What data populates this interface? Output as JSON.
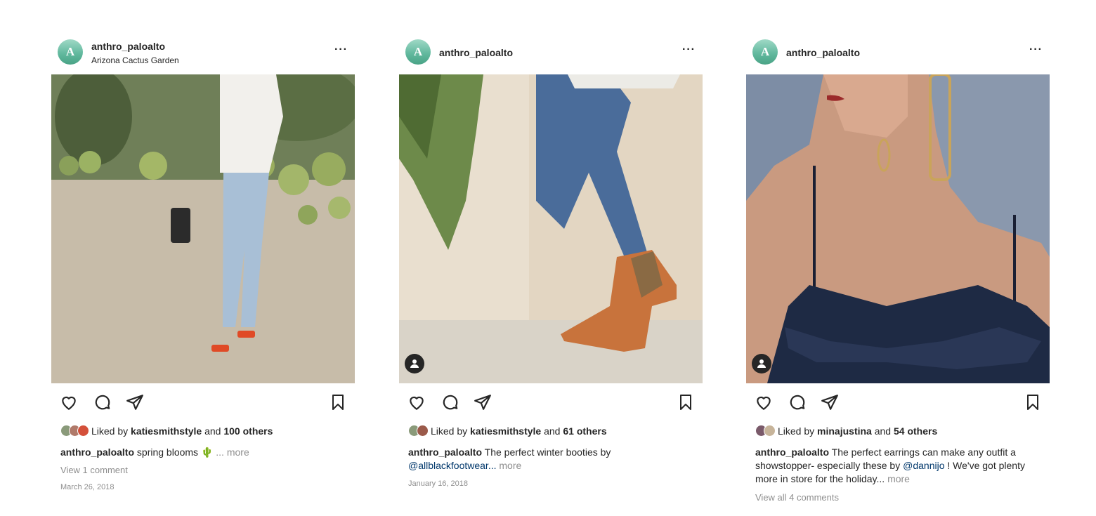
{
  "posts": [
    {
      "username": "anthro_paloalto",
      "location": "Arizona Cactus Garden",
      "avatar_letter": "A",
      "liked_by": "katiesmithstyle",
      "others": "100 others",
      "caption_user": "anthro_paloalto",
      "caption_text": "spring blooms 🌵",
      "more": "... more",
      "comments": "View 1 comment",
      "date": "March 26, 2018"
    },
    {
      "username": "anthro_paloalto",
      "avatar_letter": "A",
      "liked_by": "katiesmithstyle",
      "others": "61 others",
      "caption_user": "anthro_paloalto",
      "caption_text": "The perfect winter booties by",
      "mention": "@allblackfootwear...",
      "more": "more",
      "date": "January 16, 2018"
    },
    {
      "username": "anthro_paloalto",
      "avatar_letter": "A",
      "liked_by": "minajustina",
      "others": "54 others",
      "caption_user": "anthro_paloalto",
      "caption_text": "The perfect earrings can make any outfit a showstopper- especially these by",
      "mention": "@dannijo",
      "caption_text_2": "! We've got plenty more in store for the holiday...",
      "more": "more",
      "comments": "View all 4 comments"
    }
  ],
  "labels": {
    "liked_by_prefix": "Liked by",
    "and": "and"
  },
  "icons": [
    "heart-icon",
    "comment-icon",
    "share-icon",
    "bookmark-icon",
    "more-icon",
    "tag-user-icon"
  ],
  "colors": {
    "text": "#262626",
    "muted": "#8e8e8e",
    "mention": "#00376b",
    "avatar": "#5fb79c"
  }
}
